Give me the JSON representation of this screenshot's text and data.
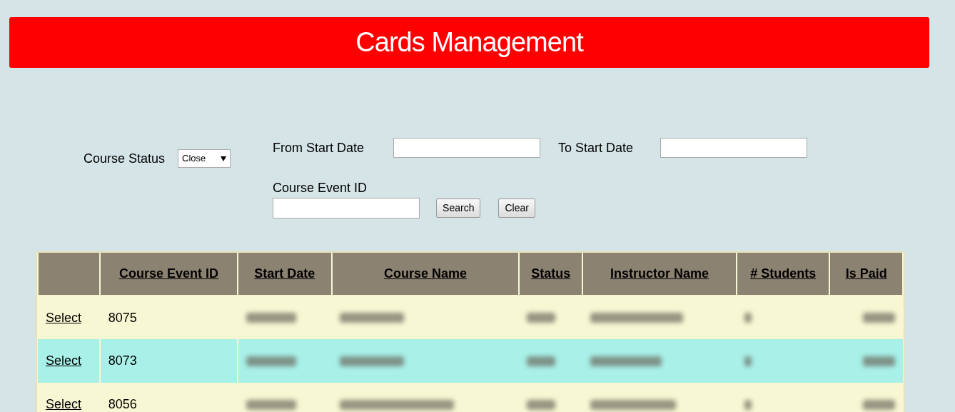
{
  "title": "Cards Management",
  "filters": {
    "course_status": {
      "label": "Course Status",
      "value": "Close"
    },
    "from_start_date": {
      "label": "From Start Date"
    },
    "to_start_date": {
      "label": "To Start Date"
    },
    "course_event_id": {
      "label": "Course Event ID"
    },
    "buttons": [
      "Search",
      "Clear"
    ]
  },
  "table": {
    "columns": [
      "",
      "Course Event ID",
      "Start Date",
      "Course Name",
      "Status",
      "Instructor Name",
      "# Students",
      "Is Paid"
    ],
    "rows": [
      {
        "action": "Select",
        "course_event_id": "8075",
        "selected": false
      },
      {
        "action": "Select",
        "course_event_id": "8073",
        "selected": true
      },
      {
        "action": "Select",
        "course_event_id": "8056",
        "selected": false
      }
    ]
  }
}
